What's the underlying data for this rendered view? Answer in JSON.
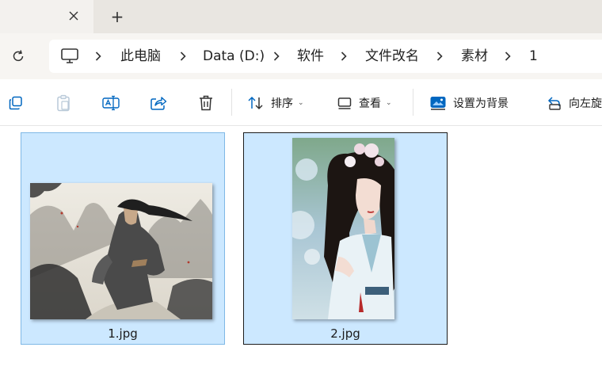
{
  "tabs": {
    "new_tab_symbol": "+"
  },
  "address": {
    "crumbs": [
      "此电脑",
      "Data (D:)",
      "软件",
      "文件改名",
      "素材",
      "1"
    ]
  },
  "commands": {
    "sort_label": "排序",
    "view_label": "查看",
    "set_background_label": "设置为背景",
    "rotate_left_label": "向左旋"
  },
  "files": [
    {
      "name": "1.jpg",
      "selected": true
    },
    {
      "name": "2.jpg",
      "selected": true
    }
  ],
  "colors": {
    "selection": "#cce8ff",
    "accent": "#0067c0"
  }
}
